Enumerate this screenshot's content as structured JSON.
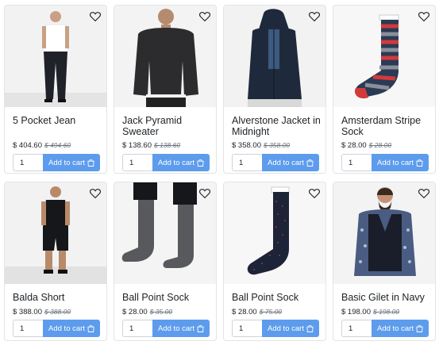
{
  "products": [
    {
      "title": "5 Pocket Jean",
      "price": "$ 404.60",
      "old_price": "$ 494.60",
      "qty": "1",
      "cart_label": "Add to cart"
    },
    {
      "title": "Jack Pyramid Sweater",
      "price": "$ 138.60",
      "old_price": "$ 138.60",
      "qty": "1",
      "cart_label": "Add to cart"
    },
    {
      "title": "Alverstone Jacket in Midnight",
      "price": "$ 358.00",
      "old_price": "$ 358.00",
      "qty": "1",
      "cart_label": "Add to cart"
    },
    {
      "title": "Amsterdam Stripe Sock",
      "price": "$ 28.00",
      "old_price": "$ 28.00",
      "qty": "1",
      "cart_label": "Add to cart"
    },
    {
      "title": "Balda Short",
      "price": "$ 388.00",
      "old_price": "$ 388.00",
      "qty": "1",
      "cart_label": "Add to cart"
    },
    {
      "title": "Ball Point Sock",
      "price": "$ 28.00",
      "old_price": "$ 35.00",
      "qty": "1",
      "cart_label": "Add to cart"
    },
    {
      "title": "Ball Point Sock",
      "price": "$ 28.00",
      "old_price": "$ 75.00",
      "qty": "1",
      "cart_label": "Add to cart"
    },
    {
      "title": "Basic Gilet in Navy",
      "price": "$ 198.00",
      "old_price": "$ 198.00",
      "qty": "1",
      "cart_label": "Add to cart"
    }
  ],
  "colors": {
    "accent": "#5d9cec",
    "border": "#e1e4e8"
  },
  "icons": {
    "wishlist": "heart-icon",
    "cart": "shopping-bag-icon"
  }
}
